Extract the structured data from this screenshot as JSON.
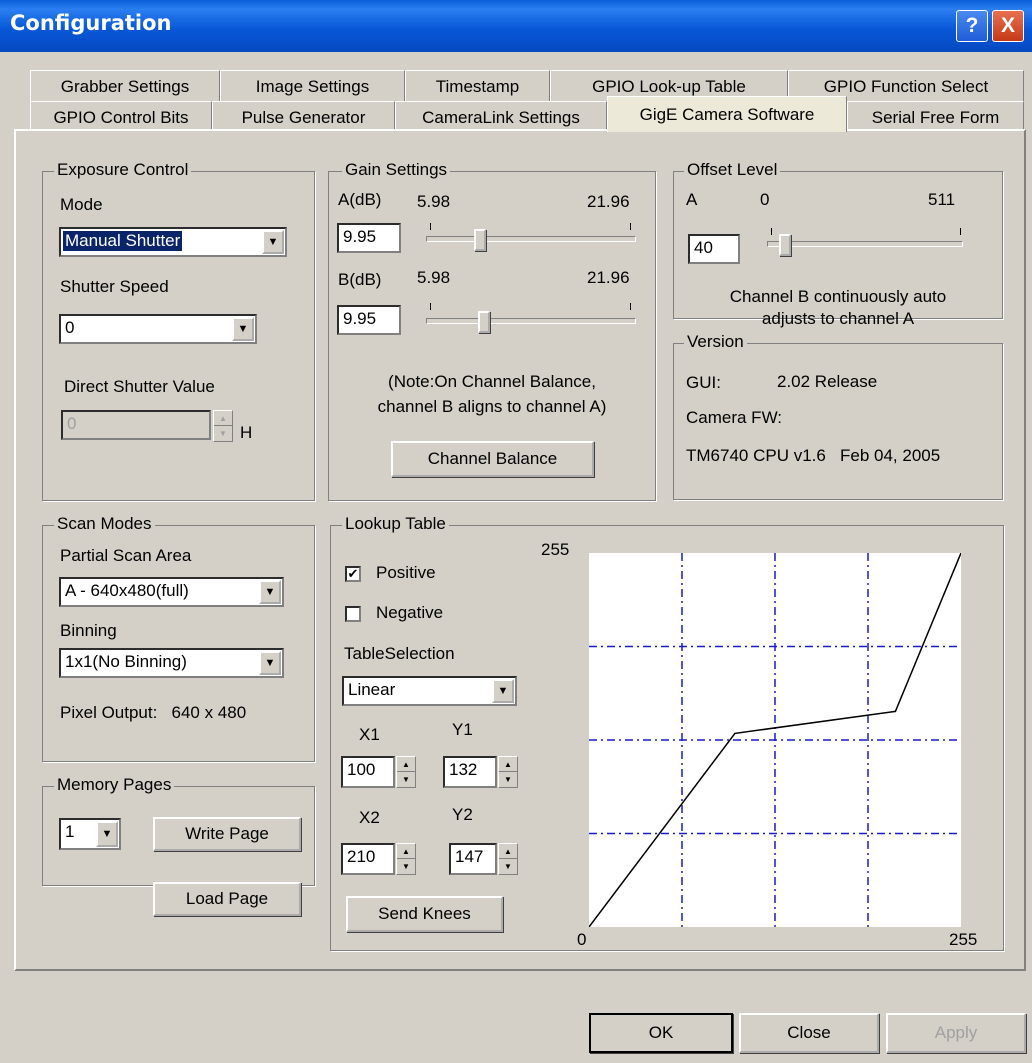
{
  "window": {
    "title": "Configuration",
    "help_label": "?",
    "close_label": "X"
  },
  "tabs": {
    "row1": [
      "Grabber Settings",
      "Image Settings",
      "Timestamp",
      "GPIO Look-up Table",
      "GPIO Function Select"
    ],
    "row2": [
      "GPIO Control Bits",
      "Pulse Generator",
      "CameraLink Settings",
      "GigE Camera Software",
      "Serial Free Form"
    ]
  },
  "exposure": {
    "title": "Exposure Control",
    "mode_label": "Mode",
    "mode_value": "Manual Shutter",
    "shutter_label": "Shutter Speed",
    "shutter_value": "0",
    "direct_label": "Direct Shutter Value",
    "direct_value": "0",
    "direct_unit": "H"
  },
  "gain": {
    "title": "Gain Settings",
    "a_label": "A(dB)",
    "a_min": "5.98",
    "a_max": "21.96",
    "a_value": "9.95",
    "b_label": "B(dB)",
    "b_min": "5.98",
    "b_max": "21.96",
    "b_value": "9.95",
    "note_line1": "(Note:On Channel Balance,",
    "note_line2": "channel B aligns to channel A)",
    "balance_button": "Channel Balance"
  },
  "offset": {
    "title": "Offset Level",
    "a_label": "A",
    "min": "0",
    "max": "511",
    "value": "40",
    "note_line1": "Channel B continuously auto",
    "note_line2": "adjusts to channel A"
  },
  "version": {
    "title": "Version",
    "gui_label": "GUI:",
    "gui_value": "2.02 Release",
    "fw_label": "Camera FW:",
    "fw_value": "TM6740 CPU v1.6   Feb 04, 2005"
  },
  "scan": {
    "title": "Scan Modes",
    "partial_label": "Partial Scan Area",
    "partial_value": "A - 640x480(full)",
    "binning_label": "Binning",
    "binning_value": "1x1(No Binning)",
    "pixel_output": "Pixel Output:   640 x 480"
  },
  "memory": {
    "title": "Memory Pages",
    "page_value": "1",
    "write_button": "Write Page",
    "load_button": "Load Page"
  },
  "lut": {
    "title": "Lookup Table",
    "positive_label": "Positive",
    "positive_checked": true,
    "negative_label": "Negative",
    "negative_checked": false,
    "selection_label": "TableSelection",
    "selection_value": "Linear",
    "x1_label": "X1",
    "y1_label": "Y1",
    "x2_label": "X2",
    "y2_label": "Y2",
    "x1": "100",
    "y1": "132",
    "x2": "210",
    "y2": "147",
    "send_button": "Send Knees",
    "axis_max_y": "255",
    "axis_min_x": "0",
    "axis_max_x": "255"
  },
  "chart_data": {
    "type": "line",
    "x": [
      0,
      100,
      210,
      255
    ],
    "y": [
      0,
      132,
      147,
      255
    ],
    "xlim": [
      0,
      255
    ],
    "ylim": [
      0,
      255
    ],
    "grid": true,
    "grid_color": "#1a1acc"
  },
  "buttons": {
    "ok": "OK",
    "close": "Close",
    "apply": "Apply"
  }
}
